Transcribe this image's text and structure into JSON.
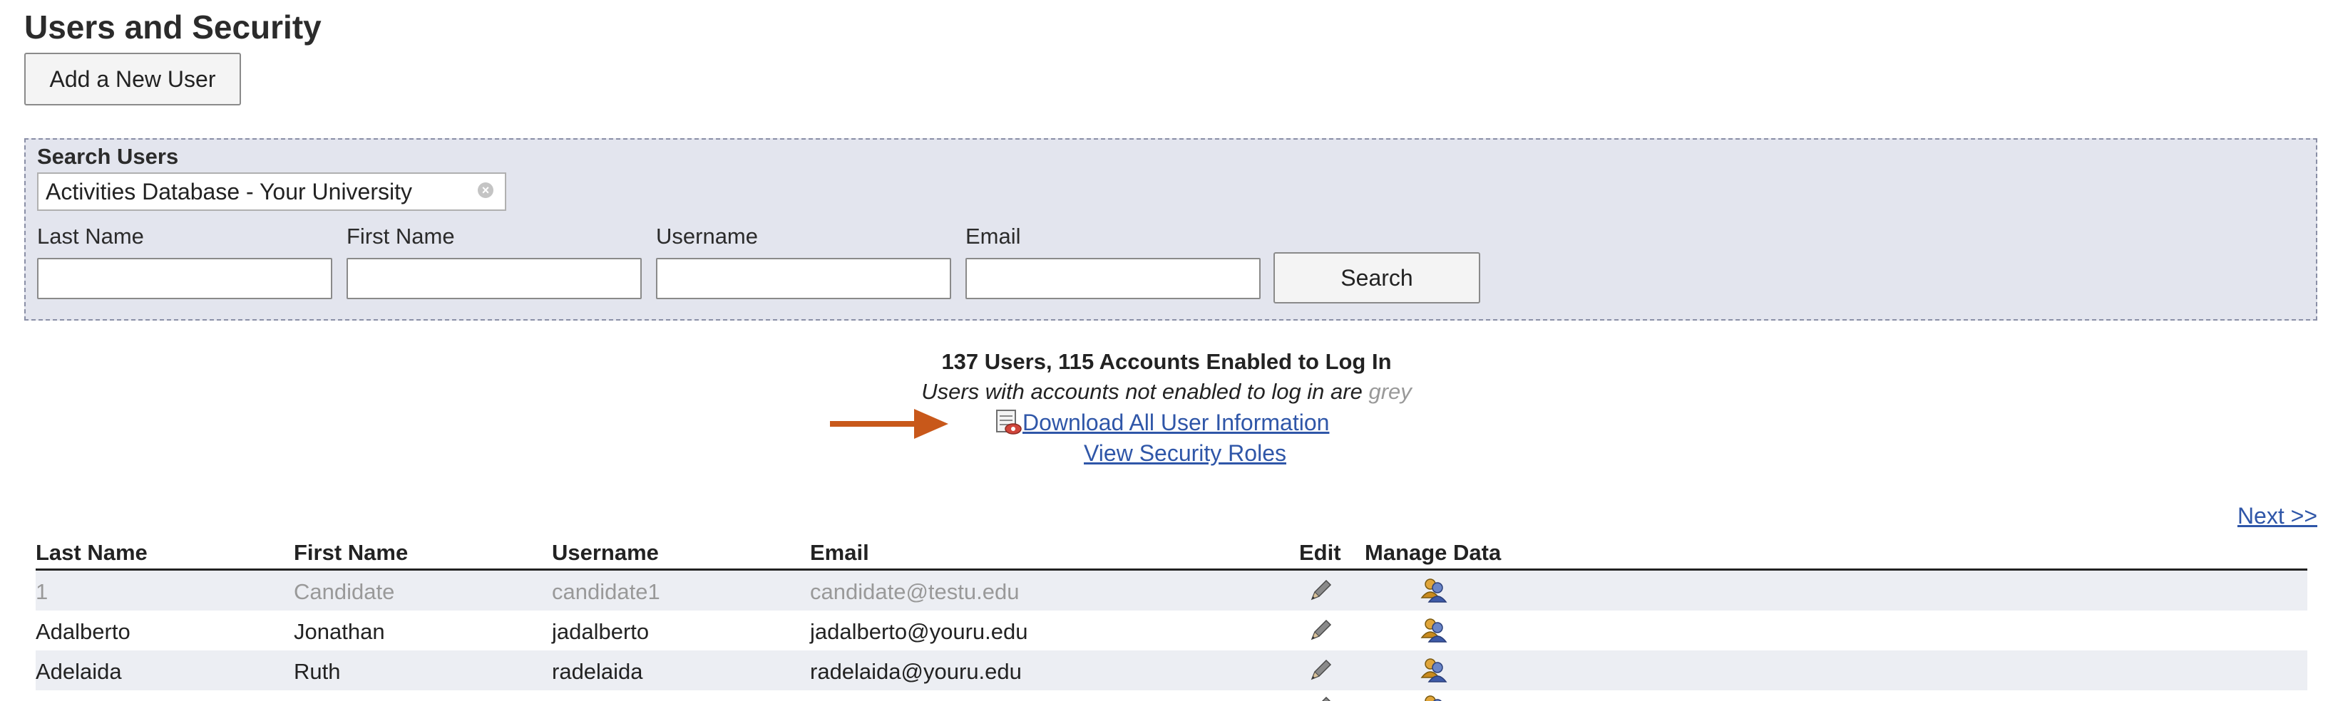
{
  "page": {
    "title": "Users and Security"
  },
  "actions": {
    "add_user_label": "Add a New User"
  },
  "search": {
    "heading": "Search Users",
    "database_value": "Activities Database - Your University",
    "fields": {
      "last_name_label": "Last Name",
      "first_name_label": "First Name",
      "username_label": "Username",
      "email_label": "Email",
      "last_name_value": "",
      "first_name_value": "",
      "username_value": "",
      "email_value": ""
    },
    "button_label": "Search"
  },
  "summary": {
    "count_text": "137 Users, 115 Accounts Enabled to Log In",
    "note_text": "Users with accounts not enabled to log in are ",
    "note_grey_word": "grey",
    "download_label": "Download All User Information",
    "roles_label": "View Security Roles",
    "arrow_color": "#c8581a"
  },
  "pagination": {
    "next_label": "Next >>"
  },
  "table": {
    "headers": {
      "last_name": "Last Name",
      "first_name": "First Name",
      "username": "Username",
      "email": "Email",
      "edit": "Edit",
      "manage": "Manage Data"
    },
    "rows": [
      {
        "last_name": "1",
        "first_name": "Candidate",
        "username": "candidate1",
        "email": "candidate@testu.edu",
        "enabled": false
      },
      {
        "last_name": "Adalberto",
        "first_name": "Jonathan",
        "username": "jadalberto",
        "email": "jadalberto@youru.edu",
        "enabled": true
      },
      {
        "last_name": "Adelaida",
        "first_name": "Ruth",
        "username": "radelaida",
        "email": "radelaida@youru.edu",
        "enabled": true
      }
    ]
  },
  "icons": {
    "edit": "pencil-icon",
    "manage": "users-icon",
    "download": "spreadsheet-download-icon",
    "clear": "clear-icon"
  },
  "colors": {
    "link": "#2f56a8",
    "search_bg": "#e3e5ee",
    "disabled_text": "#999999",
    "alt_row": "#eceef3"
  }
}
